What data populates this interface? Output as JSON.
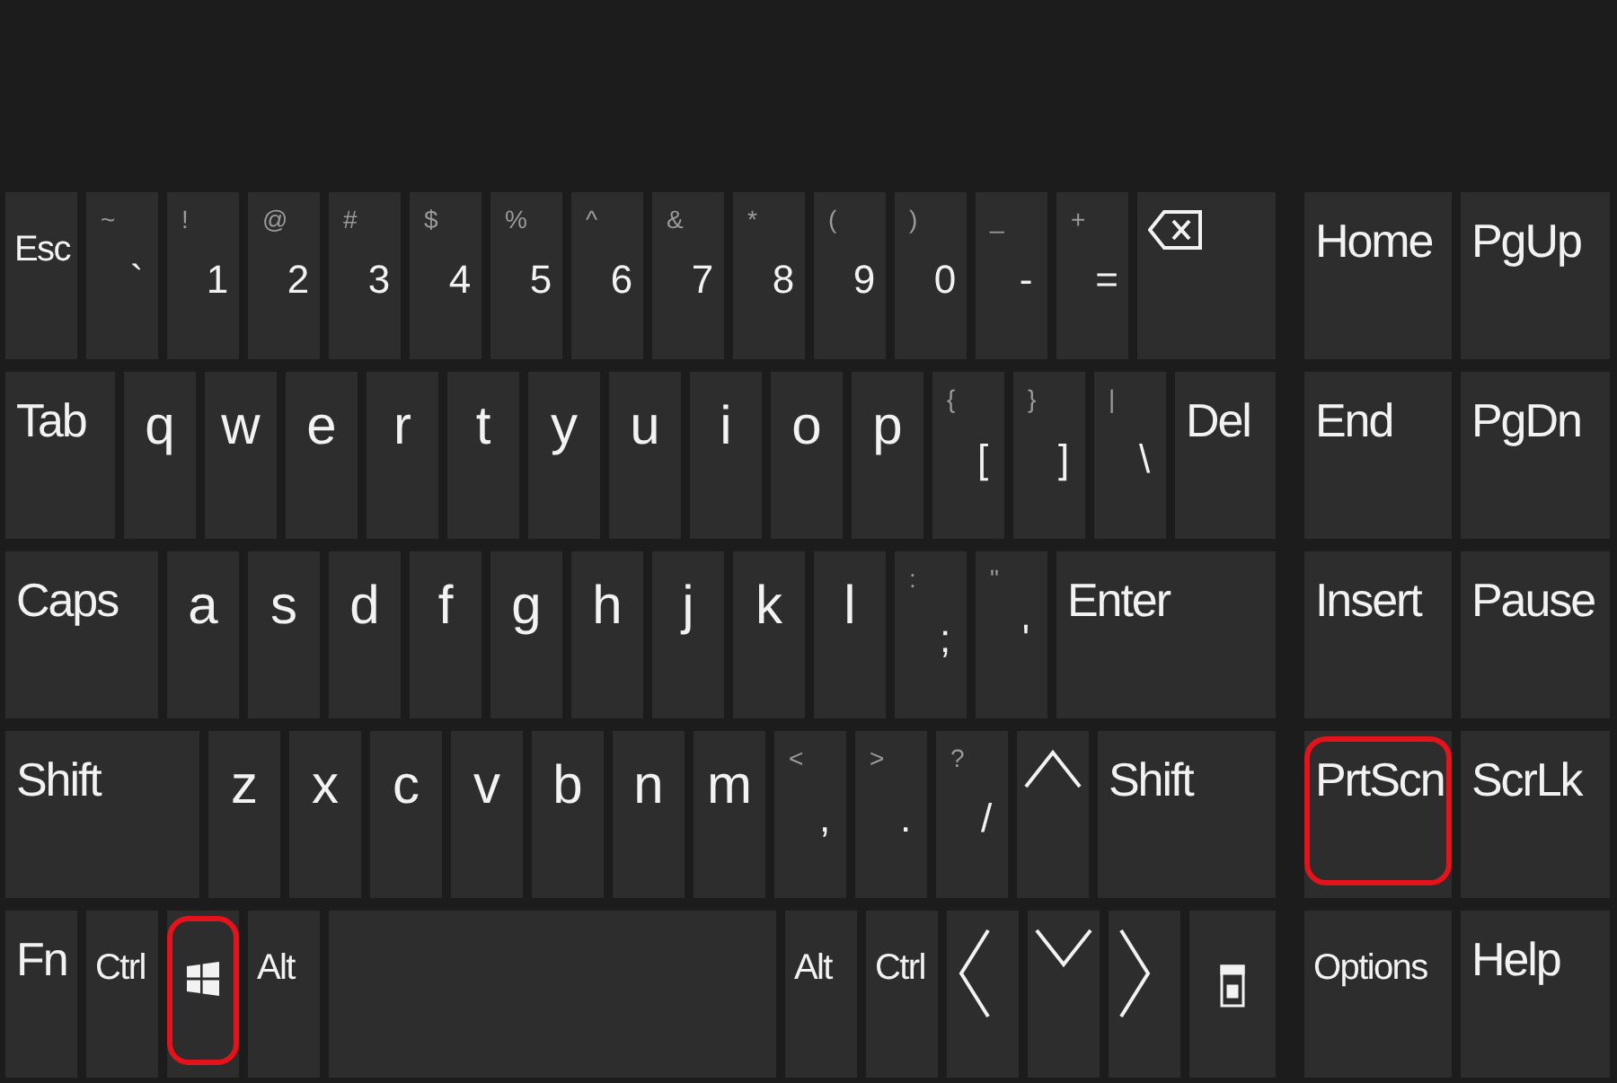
{
  "keyboard": {
    "rows": [
      {
        "keys": [
          {
            "kind": "small",
            "label": "Esc",
            "highlighted": false
          },
          {
            "kind": "dual",
            "shift": "~",
            "main": "`",
            "highlighted": false
          },
          {
            "kind": "dual",
            "shift": "!",
            "main": "1",
            "highlighted": false
          },
          {
            "kind": "dual",
            "shift": "@",
            "main": "2",
            "highlighted": false
          },
          {
            "kind": "dual",
            "shift": "#",
            "main": "3",
            "highlighted": false
          },
          {
            "kind": "dual",
            "shift": "$",
            "main": "4",
            "highlighted": false
          },
          {
            "kind": "dual",
            "shift": "%",
            "main": "5",
            "highlighted": false
          },
          {
            "kind": "dual",
            "shift": "^",
            "main": "6",
            "highlighted": false
          },
          {
            "kind": "dual",
            "shift": "&",
            "main": "7",
            "highlighted": false
          },
          {
            "kind": "dual",
            "shift": "*",
            "main": "8",
            "highlighted": false
          },
          {
            "kind": "dual",
            "shift": "(",
            "main": "9",
            "highlighted": false
          },
          {
            "kind": "dual",
            "shift": ")",
            "main": "0",
            "highlighted": false
          },
          {
            "kind": "dual",
            "shift": "_",
            "main": "-",
            "highlighted": false
          },
          {
            "kind": "dual",
            "shift": "+",
            "main": "=",
            "highlighted": false
          },
          {
            "kind": "backspace",
            "highlighted": false
          }
        ]
      },
      {
        "keys": [
          {
            "kind": "label",
            "label": "Tab",
            "highlighted": false
          },
          {
            "kind": "char",
            "label": "q",
            "highlighted": false
          },
          {
            "kind": "char",
            "label": "w",
            "highlighted": false
          },
          {
            "kind": "char",
            "label": "e",
            "highlighted": false
          },
          {
            "kind": "char",
            "label": "r",
            "highlighted": false
          },
          {
            "kind": "char",
            "label": "t",
            "highlighted": false
          },
          {
            "kind": "char",
            "label": "y",
            "highlighted": false
          },
          {
            "kind": "char",
            "label": "u",
            "highlighted": false
          },
          {
            "kind": "char",
            "label": "i",
            "highlighted": false
          },
          {
            "kind": "char",
            "label": "o",
            "highlighted": false
          },
          {
            "kind": "char",
            "label": "p",
            "highlighted": false
          },
          {
            "kind": "dual",
            "shift": "{",
            "main": "[",
            "highlighted": false
          },
          {
            "kind": "dual",
            "shift": "}",
            "main": "]",
            "highlighted": false
          },
          {
            "kind": "dual",
            "shift": "|",
            "main": "\\",
            "highlighted": false
          },
          {
            "kind": "label",
            "label": "Del",
            "highlighted": false
          }
        ]
      },
      {
        "keys": [
          {
            "kind": "label",
            "label": "Caps",
            "highlighted": false
          },
          {
            "kind": "char",
            "label": "a",
            "highlighted": false
          },
          {
            "kind": "char",
            "label": "s",
            "highlighted": false
          },
          {
            "kind": "char",
            "label": "d",
            "highlighted": false
          },
          {
            "kind": "char",
            "label": "f",
            "highlighted": false
          },
          {
            "kind": "char",
            "label": "g",
            "highlighted": false
          },
          {
            "kind": "char",
            "label": "h",
            "highlighted": false
          },
          {
            "kind": "char",
            "label": "j",
            "highlighted": false
          },
          {
            "kind": "char",
            "label": "k",
            "highlighted": false
          },
          {
            "kind": "char",
            "label": "l",
            "highlighted": false
          },
          {
            "kind": "dual",
            "shift": ":",
            "main": ";",
            "highlighted": false
          },
          {
            "kind": "dual",
            "shift": "\"",
            "main": "'",
            "highlighted": false
          },
          {
            "kind": "label",
            "label": "Enter",
            "highlighted": false
          }
        ]
      },
      {
        "keys": [
          {
            "kind": "label",
            "label": "Shift",
            "highlighted": false
          },
          {
            "kind": "char",
            "label": "z",
            "highlighted": false
          },
          {
            "kind": "char",
            "label": "x",
            "highlighted": false
          },
          {
            "kind": "char",
            "label": "c",
            "highlighted": false
          },
          {
            "kind": "char",
            "label": "v",
            "highlighted": false
          },
          {
            "kind": "char",
            "label": "b",
            "highlighted": false
          },
          {
            "kind": "char",
            "label": "n",
            "highlighted": false
          },
          {
            "kind": "char",
            "label": "m",
            "highlighted": false
          },
          {
            "kind": "dual",
            "shift": "<",
            "main": ",",
            "highlighted": false
          },
          {
            "kind": "dual",
            "shift": ">",
            "main": ".",
            "highlighted": false
          },
          {
            "kind": "dual",
            "shift": "?",
            "main": "/",
            "highlighted": false
          },
          {
            "kind": "up",
            "highlighted": false
          },
          {
            "kind": "label",
            "label": "Shift",
            "highlighted": false
          }
        ]
      },
      {
        "keys": [
          {
            "kind": "label",
            "label": "Fn",
            "highlighted": false
          },
          {
            "kind": "small",
            "label": "Ctrl",
            "highlighted": false
          },
          {
            "kind": "windows",
            "highlighted": true
          },
          {
            "kind": "small",
            "label": "Alt",
            "highlighted": false
          },
          {
            "kind": "space",
            "highlighted": false
          },
          {
            "kind": "small",
            "label": "Alt",
            "highlighted": false
          },
          {
            "kind": "small",
            "label": "Ctrl",
            "highlighted": false
          },
          {
            "kind": "left",
            "highlighted": false
          },
          {
            "kind": "down",
            "highlighted": false
          },
          {
            "kind": "right",
            "highlighted": false
          },
          {
            "kind": "menu",
            "highlighted": false
          }
        ]
      }
    ],
    "nav_keys": [
      {
        "kind": "label",
        "label": "Home",
        "highlighted": false
      },
      {
        "kind": "label",
        "label": "PgUp",
        "highlighted": false
      },
      {
        "kind": "label",
        "label": "End",
        "highlighted": false
      },
      {
        "kind": "label",
        "label": "PgDn",
        "highlighted": false
      },
      {
        "kind": "label",
        "label": "Insert",
        "highlighted": false
      },
      {
        "kind": "label",
        "label": "Pause",
        "highlighted": false
      },
      {
        "kind": "label",
        "label": "PrtScn",
        "highlighted": true
      },
      {
        "kind": "label",
        "label": "ScrLk",
        "highlighted": false
      },
      {
        "kind": "small",
        "label": "Options",
        "highlighted": false
      },
      {
        "kind": "label",
        "label": "Help",
        "highlighted": false
      }
    ]
  }
}
